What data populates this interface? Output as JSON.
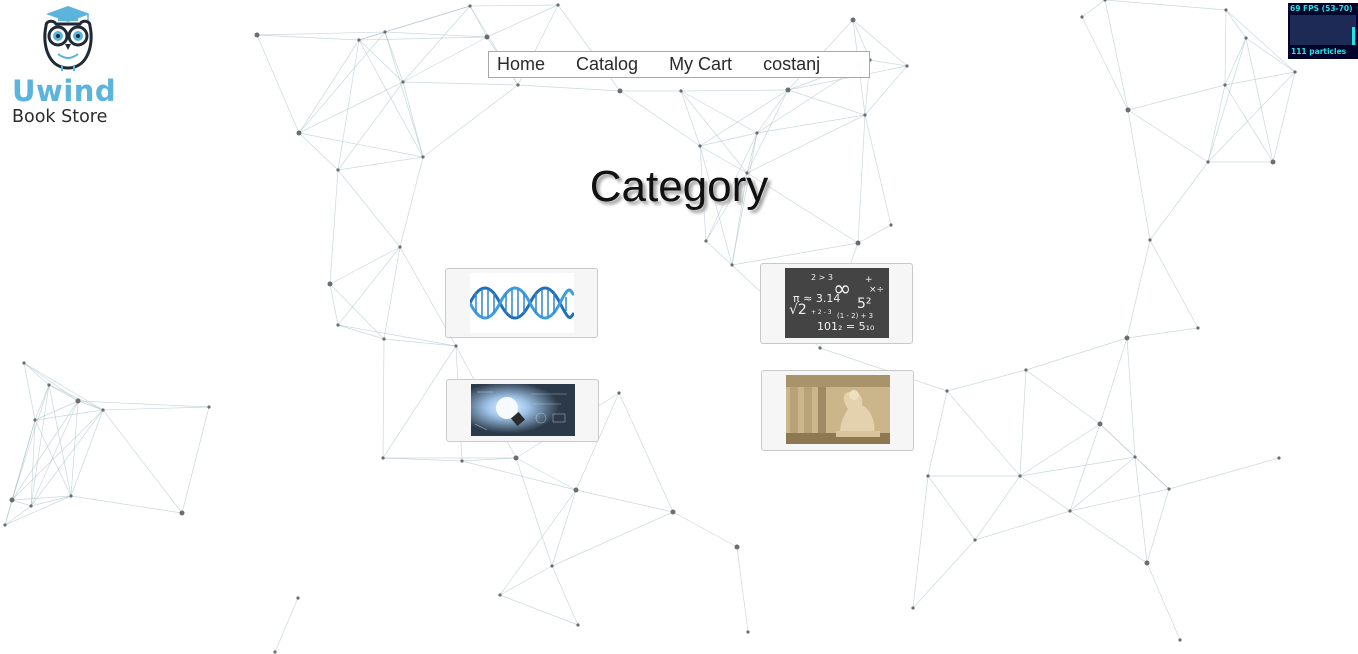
{
  "brand": {
    "name": "Uwind",
    "subtitle": "Book Store",
    "accent_color": "#5ab4dc"
  },
  "nav": {
    "items": [
      {
        "label": "Home"
      },
      {
        "label": "Catalog"
      },
      {
        "label": "My Cart"
      },
      {
        "label": "costanj"
      }
    ]
  },
  "main": {
    "title": "Category"
  },
  "categories": [
    {
      "icon": "dna-helix-image"
    },
    {
      "icon": "math-chalkboard-image"
    },
    {
      "icon": "lightbulb-idea-image"
    },
    {
      "icon": "classical-statue-image"
    }
  ],
  "fps_widget": {
    "label": "69 FPS (53-70)",
    "particles": "111 particles",
    "fps": 69,
    "fps_min": 53,
    "fps_max": 70
  }
}
